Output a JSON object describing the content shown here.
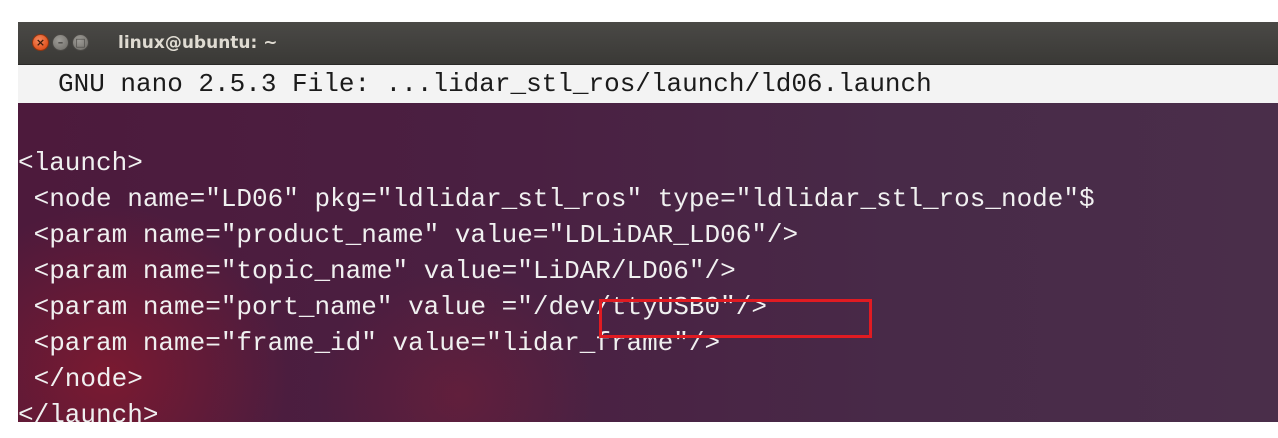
{
  "window": {
    "title": "linux@ubuntu: ~",
    "close_glyph": "×",
    "minimize_glyph": "–",
    "maximize_glyph": "□"
  },
  "nano": {
    "header": "GNU nano 2.5.3 File: ...lidar_stl_ros/launch/ld06.launch"
  },
  "file_lines": [
    "<launch>",
    " <node name=\"LD06\" pkg=\"ldlidar_stl_ros\" type=\"ldlidar_stl_ros_node\"$",
    " <param name=\"product_name\" value=\"LDLiDAR_LD06\"/>",
    " <param name=\"topic_name\" value=\"LiDAR/LD06\"/>",
    " <param name=\"port_name\" value =\"/dev/ttyUSB0\"/>",
    " <param name=\"frame_id\" value=\"lidar_frame\"/>",
    " </node>",
    "</launch>"
  ],
  "colors": {
    "highlight_border": "#e01b22",
    "terminal_text": "#f0f0f0",
    "header_background": "#f3f3f3"
  }
}
